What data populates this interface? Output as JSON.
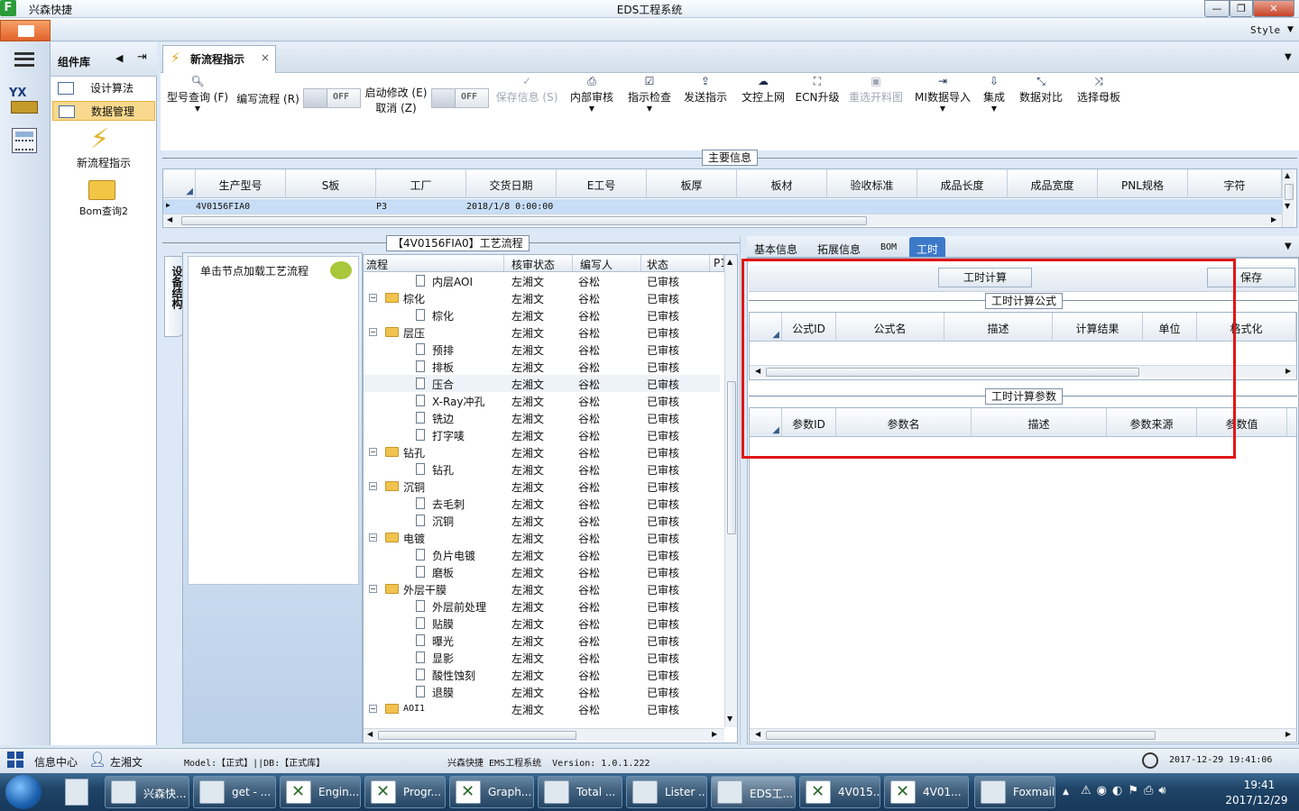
{
  "title_bar": {
    "app_name": "兴森快捷",
    "window_title": "EDS工程系统",
    "minimize": "—",
    "restore": "❐",
    "close": "✕"
  },
  "menu": {
    "style_label": "Style"
  },
  "component_panel": {
    "title": "组件库",
    "items": [
      {
        "label": "设计算法",
        "selected": false
      },
      {
        "label": "数据管理",
        "selected": true
      }
    ],
    "big_items": [
      {
        "label": "新流程指示"
      },
      {
        "label": "Bom查询2"
      }
    ]
  },
  "doc_tab": {
    "label": "新流程指示",
    "close": "×"
  },
  "toolbar": {
    "items": [
      {
        "label": "型号查询 (F)",
        "icon": "search-icon",
        "glyph": "🔍︎",
        "disabled": false
      },
      {
        "label": "编写流程 (R)",
        "icon": "none",
        "glyph": "",
        "disabled": false
      },
      {
        "label": "启动修改 (E)",
        "label2": "取消 (Z)",
        "icon": "none",
        "glyph": "",
        "disabled": false
      },
      {
        "label": "保存信息 (S)",
        "icon": "check-icon",
        "glyph": "✓",
        "disabled": true
      },
      {
        "label": "内部审核",
        "icon": "print-icon",
        "glyph": "⎙",
        "disabled": false
      },
      {
        "label": "指示检查",
        "icon": "checkbox-icon",
        "glyph": "☑",
        "disabled": false
      },
      {
        "label": "发送指示",
        "icon": "upload-icon",
        "glyph": "⇪",
        "disabled": false
      },
      {
        "label": "文控上网",
        "icon": "cloud-upload-icon",
        "glyph": "☁",
        "disabled": false
      },
      {
        "label": "ECN升级",
        "icon": "ecn-icon",
        "glyph": "⛶",
        "disabled": false
      },
      {
        "label": "重选开料图",
        "icon": "image-icon",
        "glyph": "▣",
        "disabled": true
      },
      {
        "label": "MI数据导入",
        "icon": "import-icon",
        "glyph": "⇥",
        "disabled": false
      },
      {
        "label": "集成",
        "icon": "download-icon",
        "glyph": "⇩",
        "disabled": false
      },
      {
        "label": "数据对比",
        "icon": "compare-icon",
        "glyph": "⤡",
        "disabled": false
      },
      {
        "label": "选择母板",
        "icon": "shuffle-icon",
        "glyph": "⤨",
        "disabled": false
      }
    ],
    "toggle_off": "OFF"
  },
  "main_info": {
    "title": "主要信息",
    "columns": [
      "生产型号",
      "S板",
      "工厂",
      "交货日期",
      "E工号",
      "板厚",
      "板材",
      "验收标准",
      "成品长度",
      "成品宽度",
      "PNL规格",
      "字符"
    ],
    "row": [
      "4V0156FIA0",
      "",
      "P3",
      "2018/1/8 0:00:00",
      "",
      "",
      "",
      "",
      "",
      "",
      "",
      ""
    ]
  },
  "process": {
    "title": "【4V0156FIA0】工艺流程",
    "side_tab": "设备结构",
    "hint": "单击节点加载工艺流程",
    "columns": [
      "流程",
      "核审状态",
      "编写人",
      "状态",
      "P1"
    ],
    "rows": [
      {
        "name": "内层AOI",
        "level": 2,
        "type": "doc",
        "reviewer": "左湘文",
        "writer": "谷松",
        "status": "已审核"
      },
      {
        "name": "棕化",
        "level": 1,
        "type": "folder",
        "reviewer": "左湘文",
        "writer": "谷松",
        "status": "已审核"
      },
      {
        "name": "棕化",
        "level": 2,
        "type": "doc",
        "reviewer": "左湘文",
        "writer": "谷松",
        "status": "已审核"
      },
      {
        "name": "层压",
        "level": 1,
        "type": "folder",
        "reviewer": "左湘文",
        "writer": "谷松",
        "status": "已审核"
      },
      {
        "name": "预排",
        "level": 2,
        "type": "doc",
        "reviewer": "左湘文",
        "writer": "谷松",
        "status": "已审核"
      },
      {
        "name": "排板",
        "level": 2,
        "type": "doc",
        "reviewer": "左湘文",
        "writer": "谷松",
        "status": "已审核"
      },
      {
        "name": "压合",
        "level": 2,
        "type": "doc",
        "reviewer": "左湘文",
        "writer": "谷松",
        "status": "已审核"
      },
      {
        "name": "X-Ray冲孔",
        "level": 2,
        "type": "doc",
        "reviewer": "左湘文",
        "writer": "谷松",
        "status": "已审核"
      },
      {
        "name": "铣边",
        "level": 2,
        "type": "doc",
        "reviewer": "左湘文",
        "writer": "谷松",
        "status": "已审核"
      },
      {
        "name": "打字唛",
        "level": 2,
        "type": "doc",
        "reviewer": "左湘文",
        "writer": "谷松",
        "status": "已审核"
      },
      {
        "name": "钻孔",
        "level": 1,
        "type": "folder",
        "reviewer": "左湘文",
        "writer": "谷松",
        "status": "已审核"
      },
      {
        "name": "钻孔",
        "level": 2,
        "type": "doc",
        "reviewer": "左湘文",
        "writer": "谷松",
        "status": "已审核"
      },
      {
        "name": "沉铜",
        "level": 1,
        "type": "folder",
        "reviewer": "左湘文",
        "writer": "谷松",
        "status": "已审核"
      },
      {
        "name": "去毛刺",
        "level": 2,
        "type": "doc",
        "reviewer": "左湘文",
        "writer": "谷松",
        "status": "已审核"
      },
      {
        "name": "沉铜",
        "level": 2,
        "type": "doc",
        "reviewer": "左湘文",
        "writer": "谷松",
        "status": "已审核"
      },
      {
        "name": "电镀",
        "level": 1,
        "type": "folder",
        "reviewer": "左湘文",
        "writer": "谷松",
        "status": "已审核"
      },
      {
        "name": "负片电镀",
        "level": 2,
        "type": "doc",
        "reviewer": "左湘文",
        "writer": "谷松",
        "status": "已审核"
      },
      {
        "name": "磨板",
        "level": 2,
        "type": "doc",
        "reviewer": "左湘文",
        "writer": "谷松",
        "status": "已审核"
      },
      {
        "name": "外层干膜",
        "level": 1,
        "type": "folder",
        "reviewer": "左湘文",
        "writer": "谷松",
        "status": "已审核"
      },
      {
        "name": "外层前处理",
        "level": 2,
        "type": "doc",
        "reviewer": "左湘文",
        "writer": "谷松",
        "status": "已审核"
      },
      {
        "name": "贴膜",
        "level": 2,
        "type": "doc",
        "reviewer": "左湘文",
        "writer": "谷松",
        "status": "已审核"
      },
      {
        "name": "曝光",
        "level": 2,
        "type": "doc",
        "reviewer": "左湘文",
        "writer": "谷松",
        "status": "已审核"
      },
      {
        "name": "显影",
        "level": 2,
        "type": "doc",
        "reviewer": "左湘文",
        "writer": "谷松",
        "status": "已审核"
      },
      {
        "name": "酸性蚀刻",
        "level": 2,
        "type": "doc",
        "reviewer": "左湘文",
        "writer": "谷松",
        "status": "已审核"
      },
      {
        "name": "退膜",
        "level": 2,
        "type": "doc",
        "reviewer": "左湘文",
        "writer": "谷松",
        "status": "已审核"
      },
      {
        "name": "AOI1",
        "level": 1,
        "type": "folder",
        "reviewer": "左湘文",
        "writer": "谷松",
        "status": "已审核"
      }
    ]
  },
  "right_panel": {
    "tabs": [
      {
        "label": "基本信息",
        "selected": false
      },
      {
        "label": "拓展信息",
        "selected": false
      },
      {
        "label": "BOM",
        "selected": false
      },
      {
        "label": "工时",
        "selected": true
      }
    ],
    "calc_button": "工时计算",
    "save_button": "保存",
    "formula_title": "工时计算公式",
    "formula_columns": [
      "公式ID",
      "公式名",
      "描述",
      "计算结果",
      "单位",
      "格式化"
    ],
    "param_title": "工时计算参数",
    "param_columns": [
      "参数ID",
      "参数名",
      "描述",
      "参数来源",
      "参数值"
    ]
  },
  "status_bar": {
    "info_center": "信息中心",
    "user": "左湘文",
    "model": "Model:【正式】||DB:【正式库】",
    "system": "兴森快捷 EMS工程系统  Version: 1.0.1.222",
    "datetime": "2017-12-29 19:41:06"
  },
  "taskbar": {
    "items": [
      "兴森快...",
      "get - ...",
      "Engin...",
      "Progr...",
      "Graph...",
      "Total ...",
      "Lister ...",
      "EDS工...",
      "4V015...",
      "4V01...",
      "Foxmail"
    ],
    "time": "19:41",
    "date": "2017/12/29"
  },
  "colors": {
    "highlight": "#e01616",
    "selected_tab": "#3d79c9",
    "selected_item": "#f8d98d"
  }
}
